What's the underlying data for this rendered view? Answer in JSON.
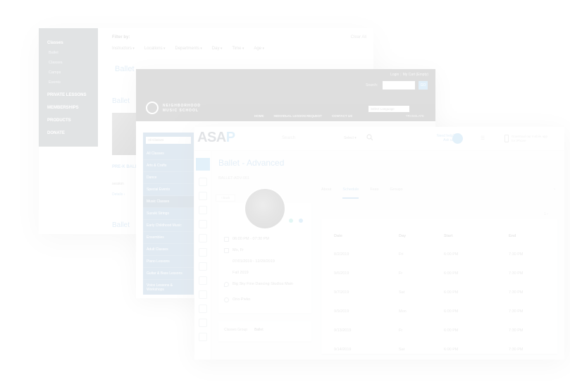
{
  "filter_page": {
    "sidebar": {
      "items": [
        {
          "label": "Classes",
          "kind": "main"
        },
        {
          "label": "Ballet",
          "kind": "sub"
        },
        {
          "label": "Classes",
          "kind": "sub"
        },
        {
          "label": "Camps",
          "kind": "sub"
        },
        {
          "label": "Events",
          "kind": "sub"
        },
        {
          "label": "PRIVATE LESSONS",
          "kind": "main"
        },
        {
          "label": "MEMBERSHIPS",
          "kind": "main"
        },
        {
          "label": "PRODUCTS",
          "kind": "main"
        },
        {
          "label": "DONATE",
          "kind": "main"
        }
      ]
    },
    "filter_by_label": "Filter by:",
    "clear_label": "Clear All",
    "filters": [
      "Instructors",
      "Locations",
      "Departments",
      "Day",
      "Time",
      "Age"
    ],
    "title": "Ballet",
    "subtitle_top": "Ballet",
    "class_title": "PRE-K BALLET",
    "session_label": "session",
    "detail_link": "Details ›",
    "bottom_title": "Ballet"
  },
  "website": {
    "login": "Login",
    "my_cart": "My Cart (Empty)",
    "search_label": "Search:",
    "go": "GO",
    "logo_text": [
      "NEIGHBORHOOD",
      "MUSIC SCHOOL"
    ],
    "language": "Select Language",
    "nav": [
      "HOME",
      "INDIVIDUAL LESSON REQUEST",
      "CONTACT US"
    ],
    "translate": "TRANSLATE",
    "sidebar_select": "All Classes",
    "sidebar_items": [
      "All Classes",
      "Arts & Crafts",
      "Dance",
      "Special Events",
      "Music Classes",
      "Suzuki Strings",
      "Early Childhood Music",
      "Ensembles",
      "Adult Classes",
      "Piano Lessons",
      "Guitar & Bass Lessons",
      "Voice Lessons & Workshops",
      "Summer Camps"
    ],
    "active_item": 4
  },
  "asap": {
    "logo": "ASA",
    "logo_p": "P",
    "search_placeholder": "Search",
    "select_label": "Select ▾",
    "help_lines": [
      "Need help?",
      "Ask us!"
    ],
    "cart": "☰",
    "mobile_lines": [
      "Download our mobile app",
      "for iPhone"
    ],
    "class_title": "Ballet - Advanced",
    "class_sub": "BALLET-ADV-001",
    "back_button": "‹ Back",
    "info": {
      "time": "06:00 PM - 07:30 PM",
      "days": "Mo, Fr",
      "dates": "07/01/2019 - 12/20/2019",
      "dates2": "Fall 2019",
      "location": "Big Sky Fine Dancing Studios Main",
      "instructor": "Orio Pivko"
    },
    "extra_label": "Classes Group",
    "extra_value": "Ballet",
    "tabs": [
      "About",
      "Schedule",
      "Fees",
      "Groups"
    ],
    "active_tab": 1,
    "schedule": {
      "headers": [
        "Date",
        "Day",
        "Start",
        "End"
      ],
      "rows": [
        [
          "8/2/2019",
          "Fri",
          "6:00 PM",
          "7:30 PM"
        ],
        [
          "9/6/2019",
          "Fr",
          "6:00 PM",
          "7:30 PM"
        ],
        [
          "9/7/2019",
          "Sat",
          "6:00 PM",
          "7:30 PM"
        ],
        [
          "9/9/2019",
          "Mon",
          "6:00 PM",
          "7:30 PM"
        ],
        [
          "9/13/2019",
          "Fr",
          "6:00 PM",
          "7:30 PM"
        ],
        [
          "9/14/2019",
          "Sat",
          "6:00 PM",
          "7:30 PM"
        ]
      ],
      "pager": "1   ›"
    }
  }
}
